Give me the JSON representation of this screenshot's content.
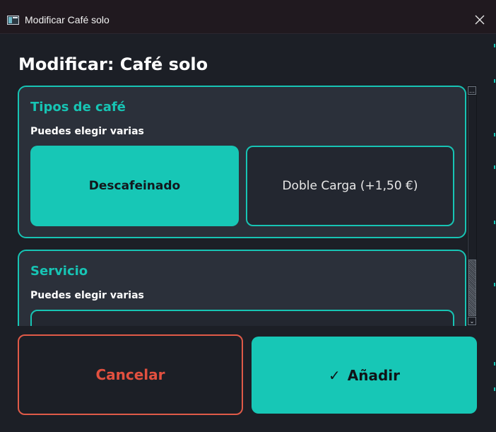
{
  "window": {
    "title": "Modificar Café solo"
  },
  "header": {
    "title": "Modificar: Café solo"
  },
  "groups": [
    {
      "title": "Tipos de café",
      "subtitle": "Puedes elegir varias",
      "options": [
        {
          "label": "Descafeinado",
          "selected": true
        },
        {
          "label": "Doble Carga (+1,50 €)",
          "selected": false
        }
      ]
    },
    {
      "title": "Servicio",
      "subtitle": "Puedes elegir varias"
    }
  ],
  "actions": {
    "cancel_label": "Cancelar",
    "add_check": "✓",
    "add_label": "Añadir"
  },
  "colors": {
    "accent": "#17c7b6",
    "danger": "#e2503f",
    "background": "#1c1f26",
    "panel": "#2b303a"
  },
  "icons": {
    "app": "window-app-icon",
    "close": "close-icon",
    "scroll_up": "scroll-up-arrow-icon",
    "scroll_down": "scroll-down-arrow-icon",
    "check": "check-icon"
  }
}
